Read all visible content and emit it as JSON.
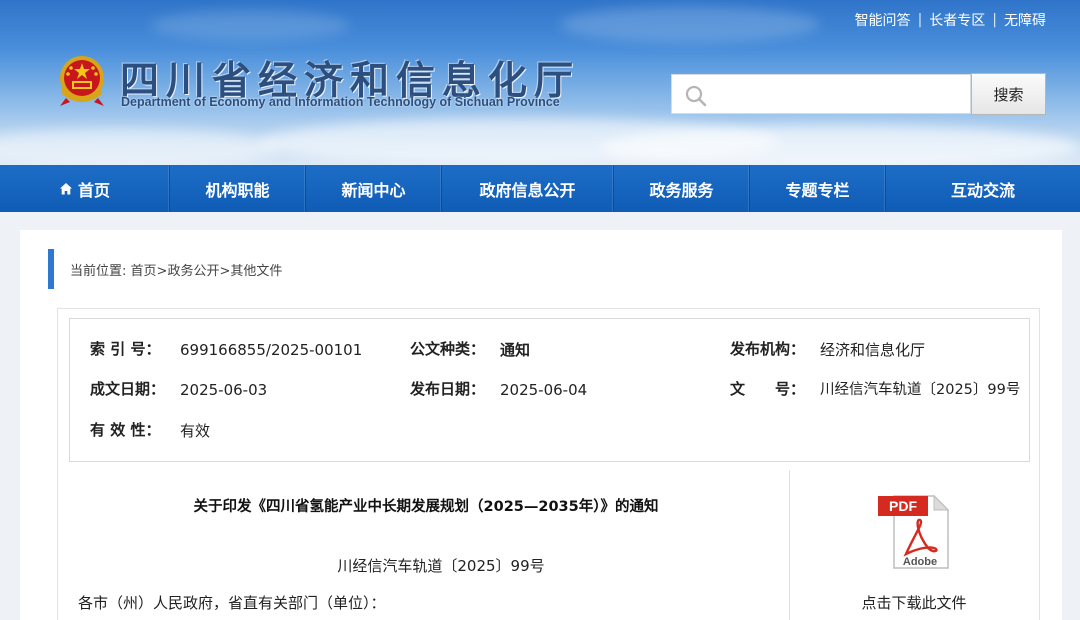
{
  "top_links": [
    "智能问答",
    "长者专区",
    "无障碍"
  ],
  "site": {
    "title": "四川省经济和信息化厅",
    "subtitle": "Department of Economy and Information Technology of Sichuan Province"
  },
  "search": {
    "placeholder": "",
    "button_label": "搜索"
  },
  "nav": [
    "首页",
    "机构职能",
    "新闻中心",
    "政府信息公开",
    "政务服务",
    "专题专栏",
    "互动交流"
  ],
  "breadcrumb": {
    "prefix": "当前位置:",
    "items": [
      "首页",
      "政务公开",
      "其他文件"
    ],
    "separator": ">"
  },
  "meta": {
    "index_label": "索 引 号：",
    "index_value": "699166855/2025-00101",
    "type_label": "公文种类：",
    "type_value": "通知",
    "issuer_label": "发布机构：",
    "issuer_value": "经济和信息化厅",
    "created_label": "成文日期：",
    "created_value": "2025-06-03",
    "published_label": "发布日期：",
    "published_value": "2025-06-04",
    "docno_label": "文　　号：",
    "docno_value": "川经信汽车轨道〔2025〕99号",
    "validity_label": "有 效 性：",
    "validity_value": "有效"
  },
  "document": {
    "title": "关于印发《四川省氢能产业中长期发展规划（2025—2035年）》的通知",
    "number": "川经信汽车轨道〔2025〕99号",
    "salutation": "各市（州）人民政府，省直有关部门（单位）："
  },
  "download": {
    "label": "点击下载此文件",
    "icon_text_top": "PDF",
    "icon_text_bottom": "Adobe"
  },
  "colors": {
    "nav_bg": "#1565c0",
    "accent_bar": "#2f78d0",
    "pdf_red": "#d42a20"
  }
}
